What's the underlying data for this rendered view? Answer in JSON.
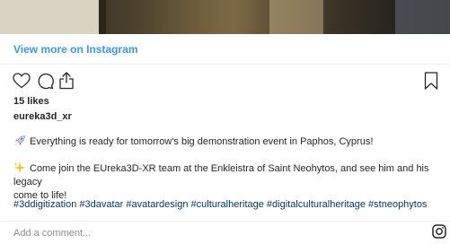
{
  "embed": {
    "view_more_label": "View more on Instagram",
    "likes": "15 likes",
    "username": "eureka3d_xr",
    "caption_line1": "Everything is ready for tomorrow's big demonstration event in Paphos, Cyprus!",
    "caption_line2a": "Come join the EUreka3D-XR team at the Enkleistra of Saint Neohytos, and see him and his legacy",
    "caption_line2b": "come to life!",
    "hashtags": "#3ddigitization #3davatar #avatardesign #culturalheritage #digitalculturalheritage #stneophytos",
    "comment_placeholder": "Add a comment..."
  },
  "icons": {
    "actions": [
      "heart-icon",
      "comment-icon",
      "share-icon"
    ],
    "bookmark": "bookmark-icon",
    "caption_emoji_1": "rocket-emoji",
    "caption_emoji_2": "sparkles-emoji",
    "footer": "instagram-icon"
  },
  "colors": {
    "link": "#3897f0",
    "hashtag": "#00376b",
    "text": "#262626",
    "muted": "#8e8e8e"
  }
}
